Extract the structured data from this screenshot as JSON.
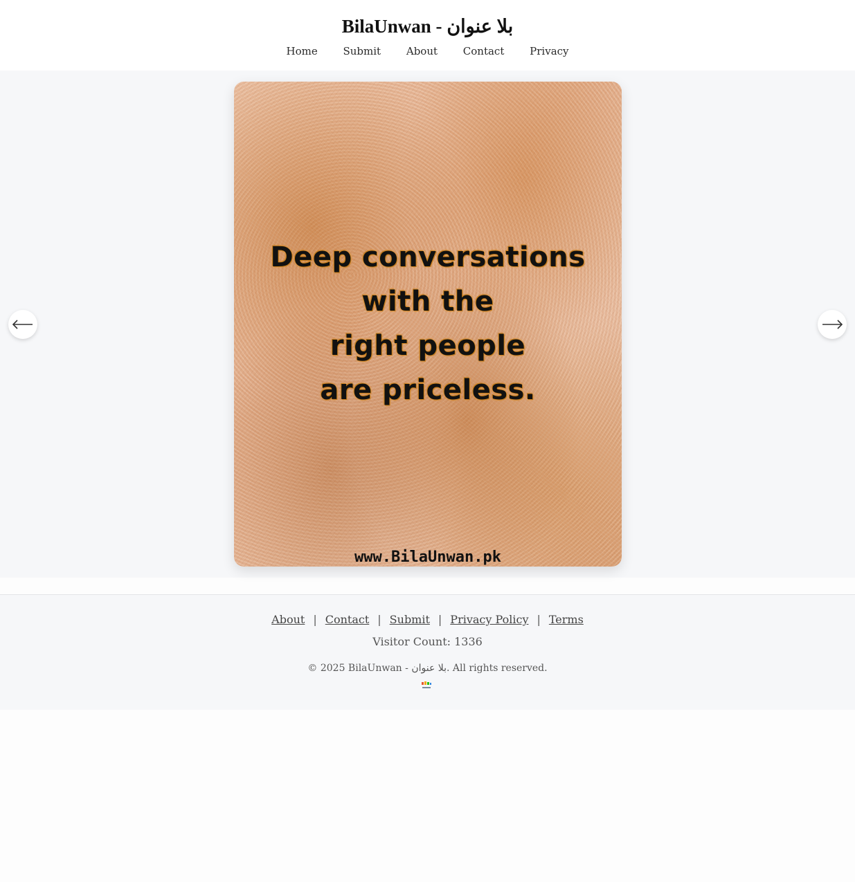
{
  "site": {
    "title": "BilaUnwan - بلا عنوان"
  },
  "nav": {
    "items": [
      "Home",
      "Submit",
      "About",
      "Contact",
      "Privacy"
    ]
  },
  "slide": {
    "quote_lines": [
      "Deep conversations",
      "with the",
      "right people",
      "are priceless."
    ],
    "watermark": "www.BilaUnwan.pk"
  },
  "carousel": {
    "prev_icon": "arrow-left-icon",
    "next_icon": "arrow-right-icon"
  },
  "footer": {
    "links": [
      "About",
      "Contact",
      "Submit",
      "Privacy Policy",
      "Terms"
    ],
    "separator": "|",
    "visitor_count": "Visitor Count: 1336",
    "copyright": "© 2025 BilaUnwan - بلا عنوان. All rights reserved."
  },
  "colors": {
    "header_bg": "#ffffff",
    "stage_bg": "#f6f7f9",
    "footer_bg": "#f6f7f9",
    "text_primary": "#111111",
    "link_color": "#444444"
  }
}
